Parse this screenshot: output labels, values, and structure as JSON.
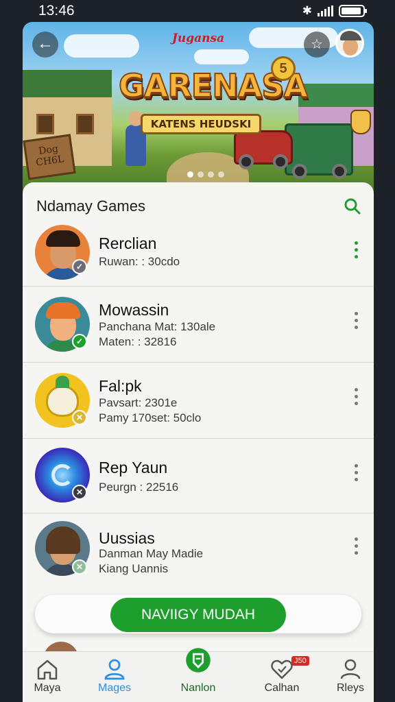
{
  "status_bar": {
    "time": "13:46"
  },
  "banner": {
    "logo_top": "Jugansa",
    "logo_title": "GARENASA",
    "logo_coin": "5",
    "logo_subtitle": "KATENS HEUDSKI",
    "sign_text": "Dog\nCH6L",
    "slides_total": 4,
    "active_slide": 0
  },
  "section": {
    "title": "Ndamay Games"
  },
  "games": [
    {
      "name": "Rerclian",
      "lines": [
        "Ruwan: : 30cdo"
      ],
      "badge_color": "#6d6d78",
      "badge_icon": "check-icon",
      "kebab_color": "#1d9e2d"
    },
    {
      "name": "Mowassin",
      "lines": [
        "Panchana Mat: 130ale",
        "Maten: : 32816"
      ],
      "badge_color": "#1d9e2d",
      "badge_icon": "check-icon",
      "kebab_color": "#777777"
    },
    {
      "name": "Fal:pk",
      "lines": [
        "Pavsart: 2301e",
        "Pamy 170set: 50clo"
      ],
      "badge_color": "#d9b53a",
      "badge_icon": "crossed-swords-icon",
      "kebab_color": "#777777"
    },
    {
      "name": "Rep Yaun",
      "lines": [
        "Peurgn : 22516"
      ],
      "badge_color": "#3a3a4a",
      "badge_icon": "crossed-swords-icon",
      "kebab_color": "#777777"
    },
    {
      "name": "Uussias",
      "lines": [
        "Danman May Madie",
        "Kiang Uannis"
      ],
      "badge_color": "#8fbf9a",
      "badge_icon": "crossed-swords-icon",
      "kebab_color": "#777777"
    }
  ],
  "cta": {
    "label": "NAVIIGY MUDAH"
  },
  "nav": [
    {
      "label": "Maya",
      "icon": "home-icon",
      "active": false
    },
    {
      "label": "Mages",
      "icon": "user-icon",
      "active": true
    },
    {
      "label": "Nanlon",
      "icon": "shield-icon",
      "active": false
    },
    {
      "label": "Calhan",
      "icon": "heart-icon",
      "active": false,
      "badge": "J50"
    },
    {
      "label": "Rleys",
      "icon": "profile-icon",
      "active": false
    }
  ],
  "colors": {
    "accent_green": "#1d9e2d",
    "active_blue": "#2c8fe0",
    "text_dark": "#111111"
  }
}
